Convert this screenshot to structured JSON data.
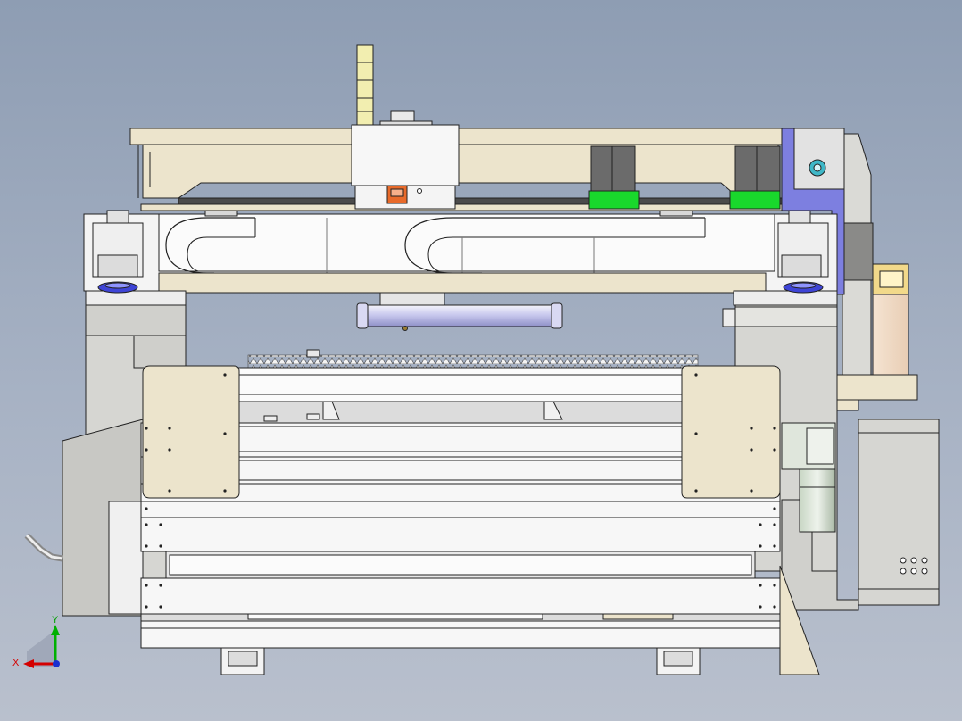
{
  "triad": {
    "x_label": "X",
    "y_label": "Y",
    "colors": {
      "x": "#d40000",
      "y": "#00b000",
      "z": "#1a30d0"
    }
  },
  "palette": {
    "background_top": "#8e9db3",
    "background_bottom": "#b9c0cd",
    "beige": "#ece4cc",
    "white_part": "#f7f7f7",
    "gray_part": "#d6d6d2",
    "dark_gray_part": "#6b6b6b",
    "green_part": "#19d82c",
    "blue_part": "#7d7fe0",
    "yellow_part": "#f2eeb0",
    "orange_part": "#e86a2a",
    "edge": "#222222"
  }
}
